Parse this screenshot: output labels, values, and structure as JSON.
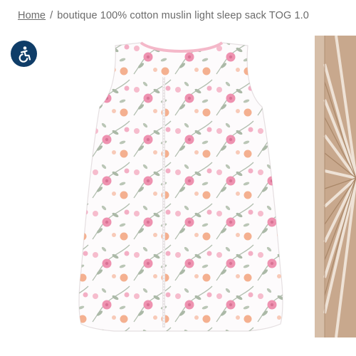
{
  "breadcrumb": {
    "home_label": "Home",
    "separator": "/",
    "current": "boutique 100% cotton muslin light sleep sack TOG 1.0"
  },
  "accessibility_button": {
    "icon": "wheelchair-accessibility-icon",
    "color": "#0f3d68"
  },
  "gallery": {
    "main_image": "sleep-sack-product-image",
    "side_image": "decor-thumbnail-image"
  },
  "colors": {
    "flower_pink": "#e87a9f",
    "flower_peach": "#f3a884",
    "leaf_green": "#9fae9b",
    "accent_navy": "#0f3d68"
  }
}
